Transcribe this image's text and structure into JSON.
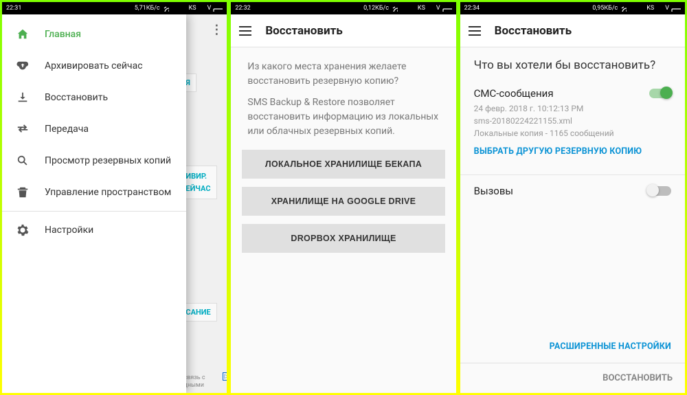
{
  "panel1": {
    "status": {
      "time": "22:31",
      "speed": "5,71КБ/с",
      "carrier": "KS",
      "v": "V"
    },
    "drawer": {
      "items": [
        {
          "label": "Главная",
          "icon": "home",
          "active": true
        },
        {
          "label": "Архивировать сейчас",
          "icon": "backup"
        },
        {
          "label": "Восстановить",
          "icon": "download"
        },
        {
          "label": "Передача",
          "icon": "transfer"
        },
        {
          "label": "Просмотр резервных копий",
          "icon": "search"
        },
        {
          "label": "Управление пространством",
          "icon": "trash"
        },
        {
          "label": "Настройки",
          "icon": "gear"
        }
      ]
    },
    "bg": {
      "chip1": "Я",
      "chip2a": "ИВИР.",
      "chip2b": "ЕЙЧАС",
      "chip3": "САНИЕ",
      "ad1": "связь с",
      "ad2": "дными"
    }
  },
  "panel2": {
    "status": {
      "time": "22:32",
      "speed": "0,12КБ/с",
      "carrier": "KS",
      "v": "V"
    },
    "title": "Восстановить",
    "body1": "Из какого места хранения желаете восстановить резервную копию?",
    "body2": "SMS Backup & Restore позволяет восстановить информацию из локальных или облачных резервных копий.",
    "buttons": [
      "ЛОКАЛЬНОЕ ХРАНИЛИЩЕ БЕКАПА",
      "ХРАНИЛИЩЕ НА GOOGLE DRIVE",
      "DROPBOX ХРАНИЛИЩЕ"
    ]
  },
  "panel3": {
    "status": {
      "time": "22:34",
      "speed": "0,95КБ/с",
      "carrier": "KS",
      "v": "V"
    },
    "title": "Восстановить",
    "heading": "Что вы хотели бы восстановить?",
    "sms": {
      "title": "СМС-сообщения",
      "date": "24 февр. 2018 г. 10:12:13 PM",
      "file": "sms-20180224221155.xml",
      "count": "Локальные копия - 1165 сообщений",
      "link": "ВЫБРАТЬ ДРУГУЮ РЕЗЕРВНУЮ КОПИЮ"
    },
    "calls": {
      "title": "Вызовы"
    },
    "advanced": "РАСШИРЕННЫЕ НАСТРОЙКИ",
    "restore": "ВОССТАНОВИТЬ"
  }
}
